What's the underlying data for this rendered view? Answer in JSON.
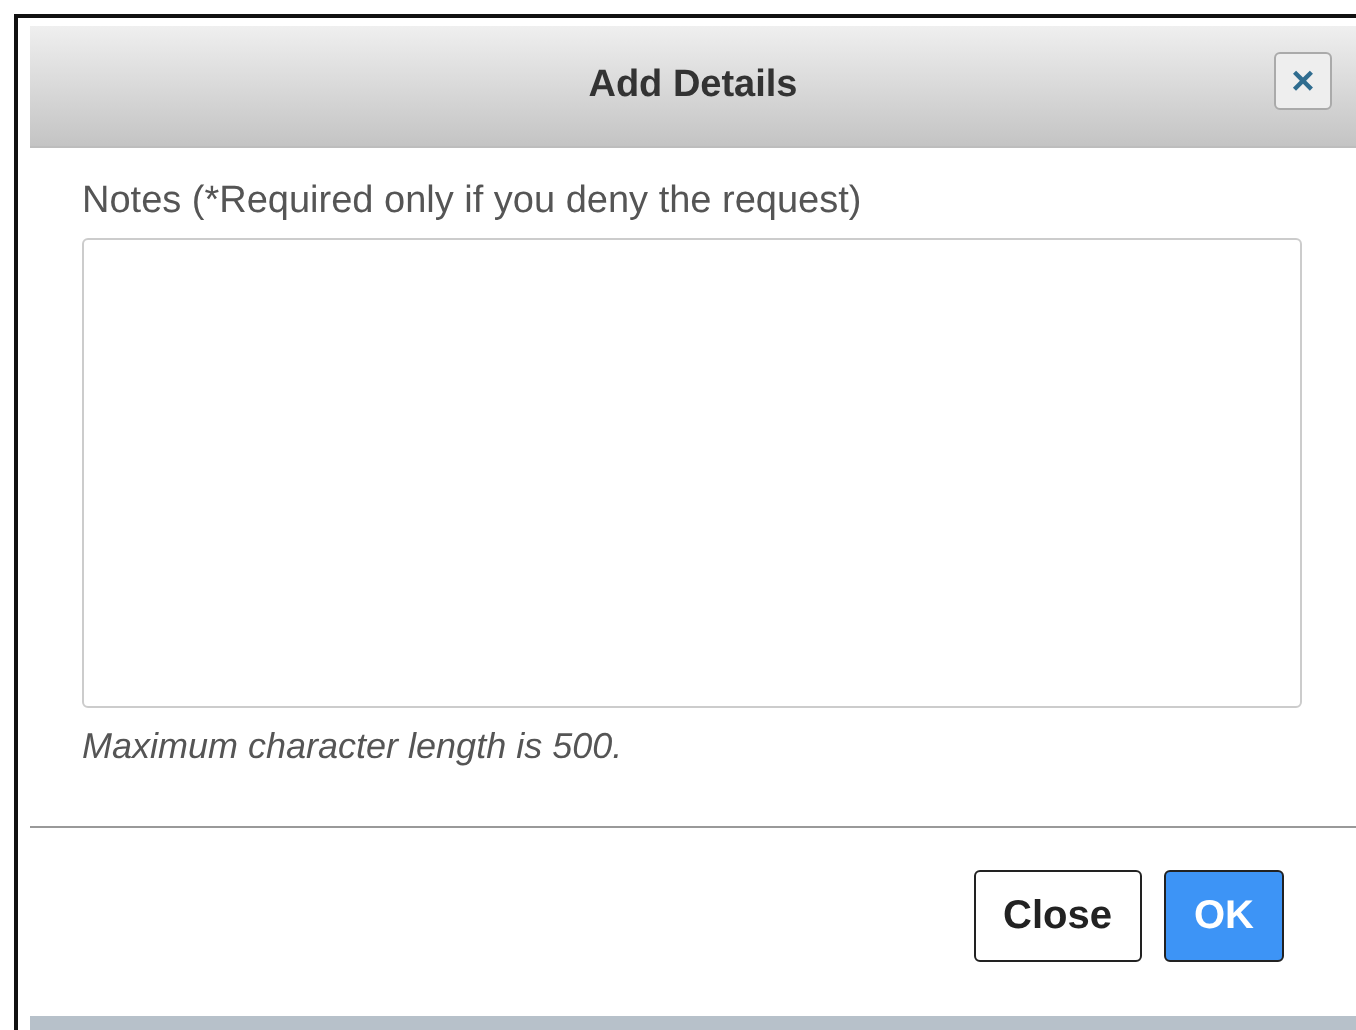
{
  "dialog": {
    "title": "Add Details",
    "close_icon": "×"
  },
  "notes": {
    "label": "Notes (*Required only if you deny the request)",
    "hint": "Maximum character length is 500."
  },
  "buttons": [
    {
      "label": "Close",
      "kind": "default"
    },
    {
      "label": "OK",
      "kind": "primary"
    }
  ]
}
